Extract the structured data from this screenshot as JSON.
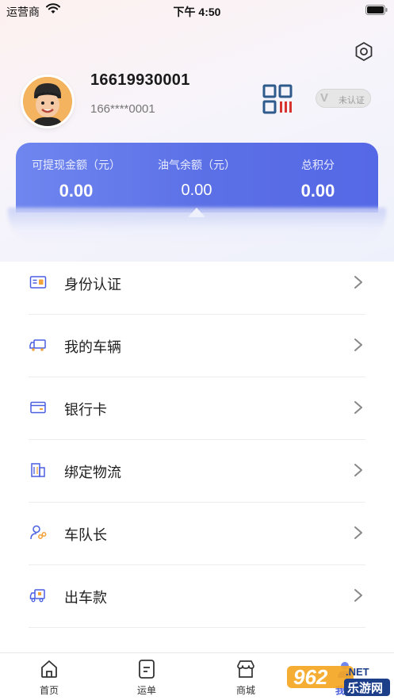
{
  "status_bar": {
    "carrier": "运营商",
    "time": "下午 4:50"
  },
  "profile": {
    "phone": "16619930001",
    "phone_masked": "166****0001",
    "cert_label": "未认证",
    "cert_mark": "V"
  },
  "stats": [
    {
      "label": "可提现金额（元）",
      "value": "0.00"
    },
    {
      "label": "油气余额（元）",
      "value": "0.00"
    },
    {
      "label": "总积分",
      "value": "0.00"
    }
  ],
  "menu": [
    {
      "label": "身份认证",
      "icon": "id-card-icon"
    },
    {
      "label": "我的车辆",
      "icon": "truck-icon"
    },
    {
      "label": "银行卡",
      "icon": "bank-card-icon"
    },
    {
      "label": "绑定物流",
      "icon": "building-icon"
    },
    {
      "label": "车队长",
      "icon": "person-link-icon"
    },
    {
      "label": "出车款",
      "icon": "cargo-truck-icon"
    }
  ],
  "tabs": [
    {
      "label": "首页",
      "icon": "home-icon"
    },
    {
      "label": "运单",
      "icon": "waybill-icon"
    },
    {
      "label": "商城",
      "icon": "shop-icon"
    },
    {
      "label": "我的",
      "icon": "profile-icon"
    }
  ],
  "watermark": {
    "brand": "962",
    "suffix": ".NET",
    "site": "乐游网"
  },
  "colors": {
    "accent": "#5b6fe6",
    "qr_blue": "#2e5a8c",
    "qr_red": "#d7332f",
    "icon_blue": "#4a5fe0",
    "icon_orange": "#f2a33a"
  }
}
